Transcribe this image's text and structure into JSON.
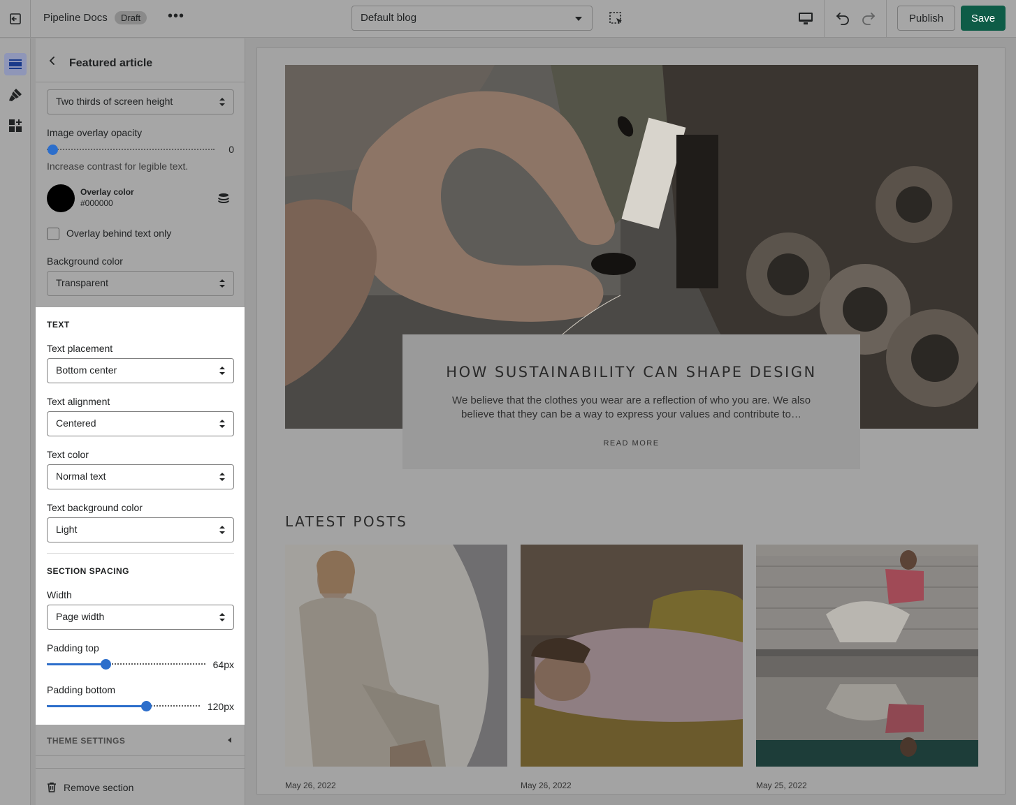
{
  "topbar": {
    "store_name": "Pipeline Docs",
    "status_badge": "Draft",
    "more_label": "•••",
    "template_select": "Default blog",
    "publish_label": "Publish",
    "save_label": "Save",
    "save_color": "#0e5c47"
  },
  "rail": {
    "items": [
      {
        "icon": "sections-icon",
        "active": true
      },
      {
        "icon": "theme-settings-brush-icon",
        "active": false
      },
      {
        "icon": "app-blocks-icon",
        "active": false
      }
    ]
  },
  "panel": {
    "title": "Featured article",
    "image_height_select": "Two thirds of screen height",
    "overlay_opacity_label": "Image overlay opacity",
    "overlay_opacity_value": "0",
    "overlay_opacity_fraction": 0,
    "overlay_help": "Increase contrast for legible text.",
    "overlay_color_label": "Overlay color",
    "overlay_color_value": "#000000",
    "overlay_behind_text_label": "Overlay behind text only",
    "overlay_behind_text_checked": false,
    "background_color_label": "Background color",
    "background_color_value": "Transparent",
    "text_heading": "TEXT",
    "text_placement_label": "Text placement",
    "text_placement_value": "Bottom center",
    "text_alignment_label": "Text alignment",
    "text_alignment_value": "Centered",
    "text_color_label": "Text color",
    "text_color_value": "Normal text",
    "text_bg_color_label": "Text background color",
    "text_bg_color_value": "Light",
    "section_spacing_heading": "SECTION SPACING",
    "width_label": "Width",
    "width_value": "Page width",
    "padding_top_label": "Padding top",
    "padding_top_value": "64px",
    "padding_top_fraction": 0.36,
    "padding_bottom_label": "Padding bottom",
    "padding_bottom_value": "120px",
    "padding_bottom_fraction": 0.66,
    "theme_settings_label": "THEME SETTINGS",
    "remove_section_label": "Remove section"
  },
  "preview": {
    "hero_title": "HOW SUSTAINABILITY CAN SHAPE DESIGN",
    "hero_description": "We believe that the clothes you wear are a reflection of who you are. We also believe that they can be a way to express your values and contribute to…",
    "hero_link": "READ MORE",
    "latest_heading": "LATEST POSTS",
    "posts": [
      {
        "date": "May 26, 2022"
      },
      {
        "date": "May 26, 2022"
      },
      {
        "date": "May 25, 2022"
      }
    ]
  }
}
